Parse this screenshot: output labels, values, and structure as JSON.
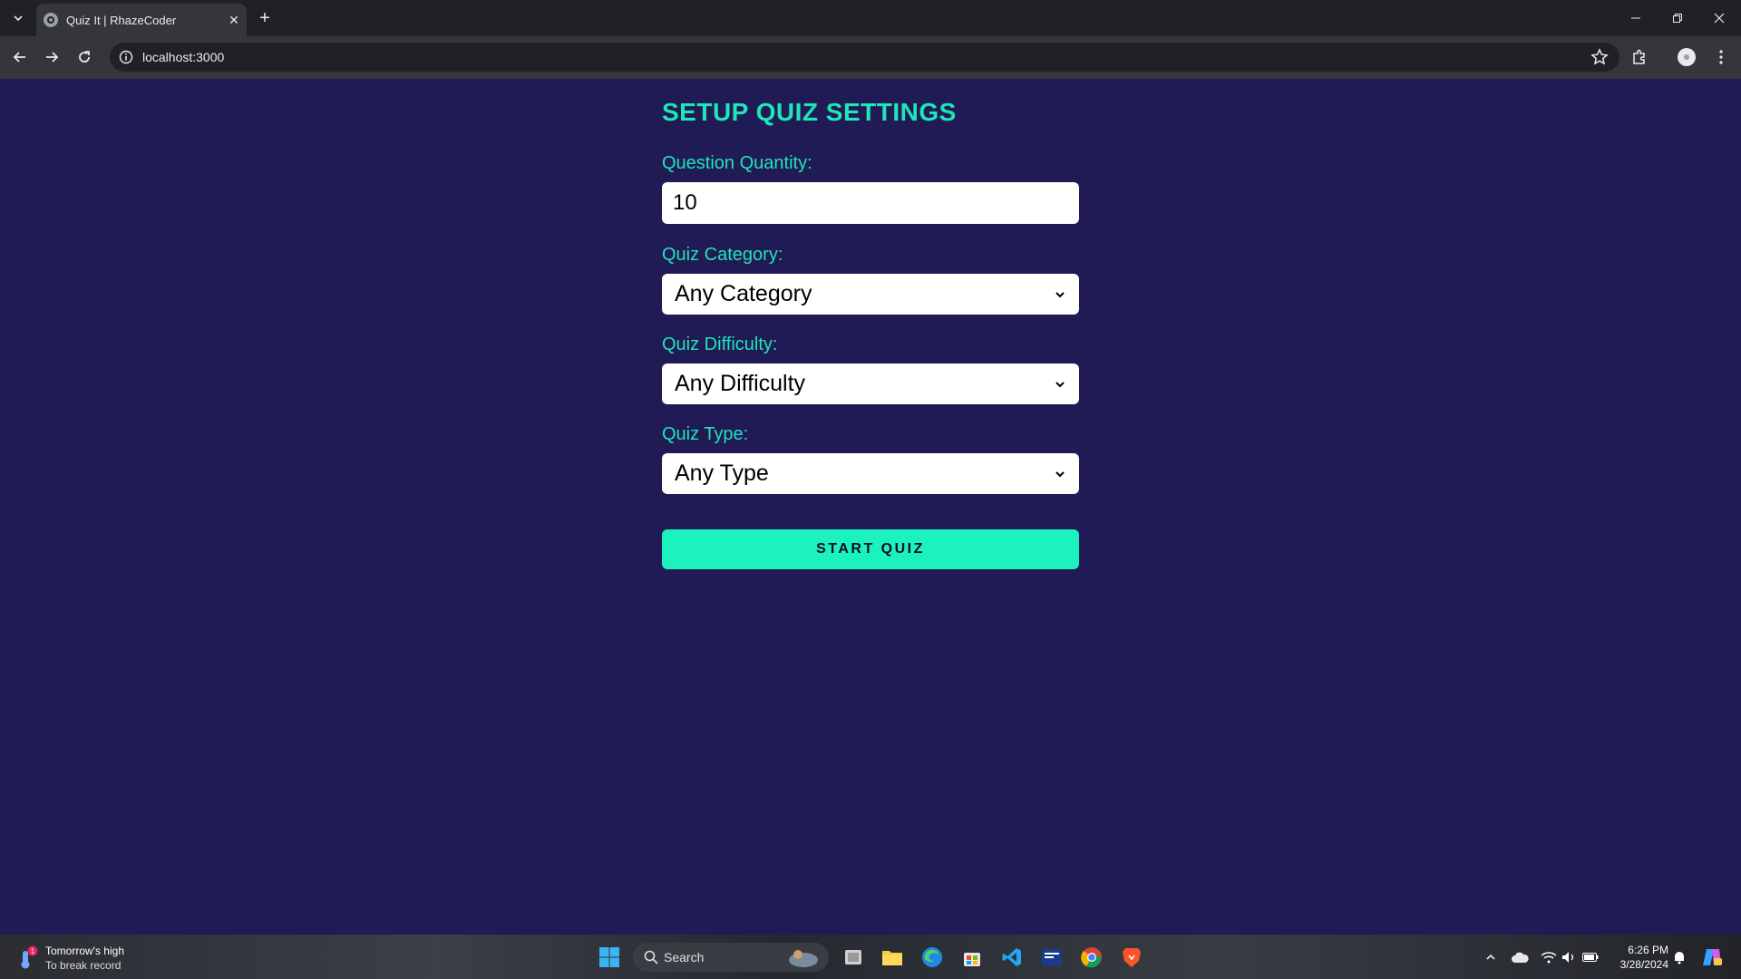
{
  "browser": {
    "tab_title": "Quiz It | RhazeCoder",
    "url": "localhost:3000"
  },
  "form": {
    "heading": "SETUP QUIZ SETTINGS",
    "quantity_label": "Question Quantity:",
    "quantity_value": "10",
    "category_label": "Quiz Category:",
    "category_value": "Any Category",
    "difficulty_label": "Quiz Difficulty:",
    "difficulty_value": "Any Difficulty",
    "type_label": "Quiz Type:",
    "type_value": "Any Type",
    "start_label": "START QUIZ"
  },
  "taskbar": {
    "weather_line1": "Tomorrow's high",
    "weather_line2": "To break record",
    "weather_badge": "1",
    "search_label": "Search",
    "time": "6:26 PM",
    "date": "3/28/2024"
  },
  "colors": {
    "page_bg": "#201a55",
    "accent": "#1ee6b8",
    "button": "#1cf2bd"
  }
}
